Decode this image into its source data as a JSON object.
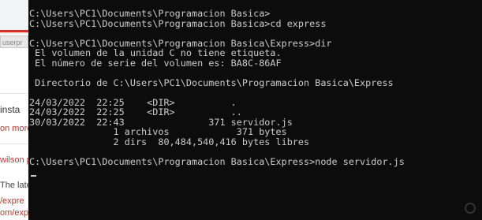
{
  "background_browser": {
    "field_text": "userpr",
    "snippets": [
      "insta",
      "on more",
      "wilson p",
      "The lates",
      "/expre",
      "om/expr"
    ]
  },
  "terminal": {
    "lines": [
      "C:\\Users\\PC1\\Documents\\Programacion Basica>",
      "C:\\Users\\PC1\\Documents\\Programacion Basica>cd express",
      "",
      "C:\\Users\\PC1\\Documents\\Programacion Basica\\Express>dir",
      " El volumen de la unidad C no tiene etiqueta.",
      " El número de serie del volumen es: BA8C-86AF",
      "",
      " Directorio de C:\\Users\\PC1\\Documents\\Programacion Basica\\Express",
      "",
      "24/03/2022  22:25    <DIR>          .",
      "24/03/2022  22:25    <DIR>          ..",
      "30/03/2022  22:43               371 servidor.js",
      "               1 archivos            371 bytes",
      "               2 dirs  80,484,540,416 bytes libres",
      "",
      "C:\\Users\\PC1\\Documents\\Programacion Basica\\Express>node servidor.js"
    ]
  },
  "colors": {
    "terminal_bg": "#0c0c0c",
    "terminal_fg": "#cccccc"
  }
}
